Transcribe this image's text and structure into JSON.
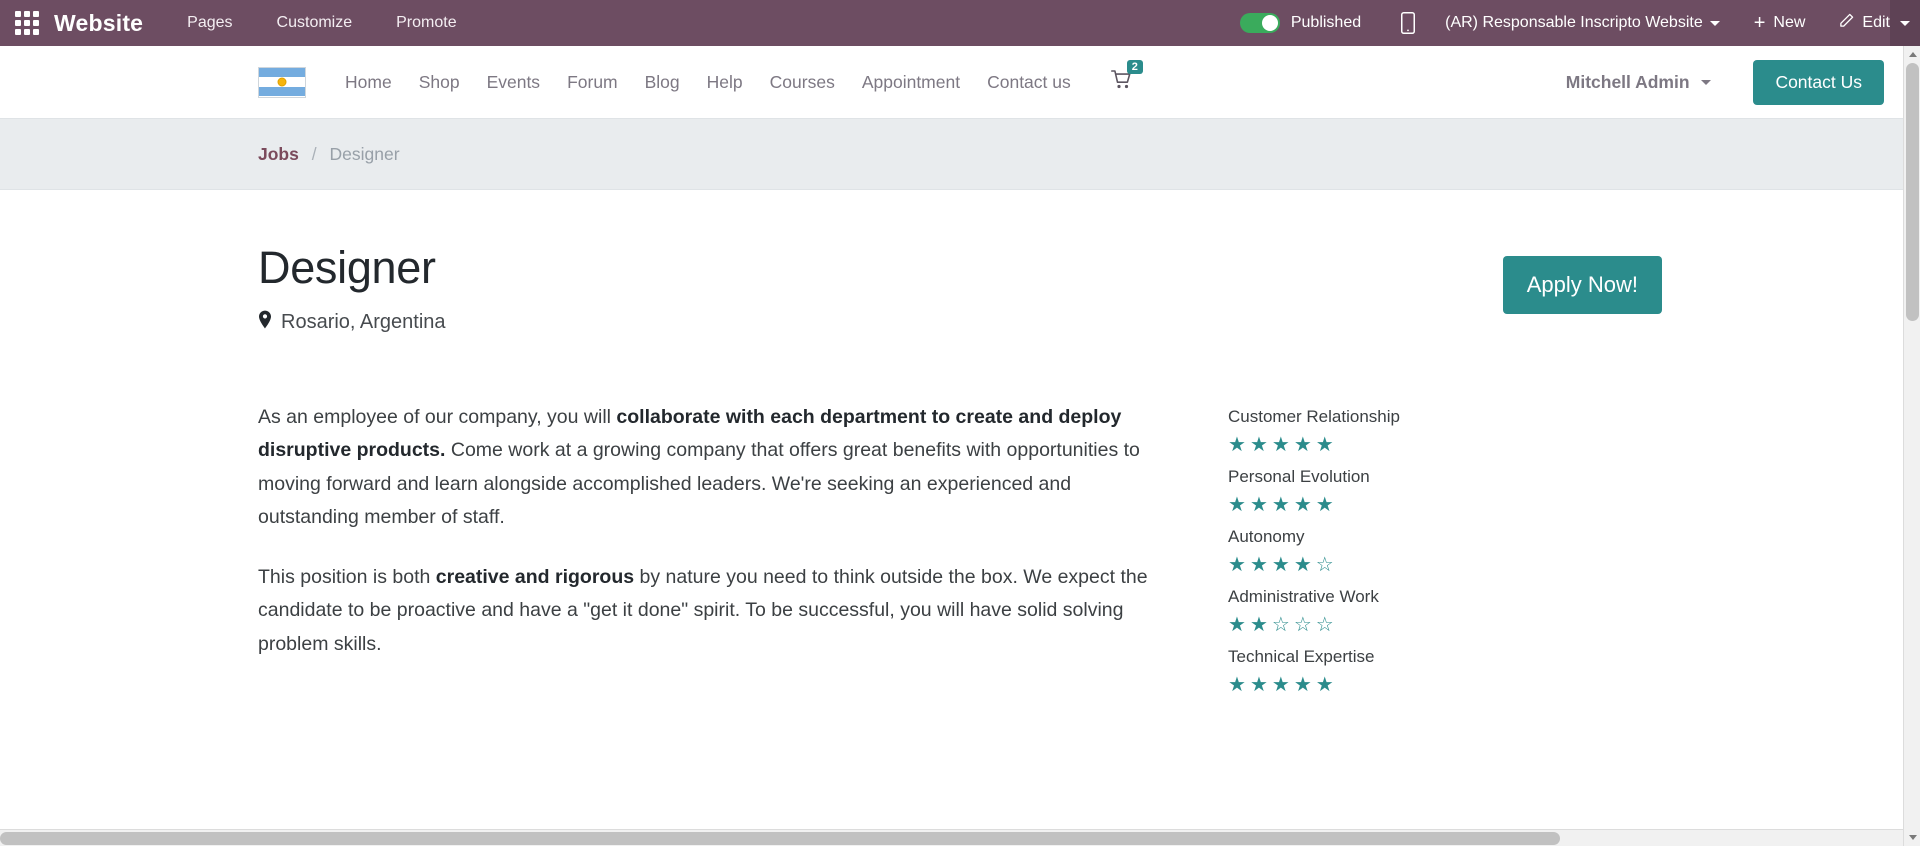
{
  "topbar": {
    "apps_icon": "grid-apps-icon",
    "brand": "Website",
    "menus": [
      "Pages",
      "Customize",
      "Promote"
    ],
    "published_label": "Published",
    "published_on": true,
    "mobile_icon": "mobile-preview-icon",
    "website_selector": "(AR) Responsable Inscripto Website",
    "new_label": "New",
    "new_icon": "plus-icon",
    "edit_label": "Edit",
    "edit_icon": "pencil-icon",
    "accent_color": "#6d4d62",
    "toggle_color": "#3aab5c"
  },
  "site_nav": {
    "logo": "argentina-flag-logo",
    "links": [
      "Home",
      "Shop",
      "Events",
      "Forum",
      "Blog",
      "Help",
      "Courses",
      "Appointment",
      "Contact us"
    ],
    "cart_icon": "shopping-cart-icon",
    "cart_count": "2",
    "user_name": "Mitchell Admin",
    "cta_label": "Contact Us",
    "cta_color": "#2b8c8c"
  },
  "breadcrumb": {
    "parent": "Jobs",
    "separator": "/",
    "current": "Designer"
  },
  "job": {
    "title": "Designer",
    "location_icon": "map-marker-icon",
    "location": "Rosario, Argentina",
    "apply_label": "Apply Now!"
  },
  "description": {
    "p1_a": "As an employee of our company, you will ",
    "p1_b": "collaborate with each department to create and deploy disruptive products.",
    "p1_c": " Come work at a growing company that offers great benefits with opportunities to moving forward and learn alongside accomplished leaders. We're seeking an experienced and outstanding member of staff.",
    "p2_a": "This position is both ",
    "p2_b": "creative and rigorous",
    "p2_c": " by nature you need to think outside the box. We expect the candidate to be proactive and have a \"get it done\" spirit. To be successful, you will have solid solving problem skills."
  },
  "ratings": [
    {
      "label": "Customer Relationship",
      "value": 5,
      "max": 5
    },
    {
      "label": "Personal Evolution",
      "value": 5,
      "max": 5
    },
    {
      "label": "Autonomy",
      "value": 4,
      "max": 5
    },
    {
      "label": "Administrative Work",
      "value": 2,
      "max": 5
    },
    {
      "label": "Technical Expertise",
      "value": 5,
      "max": 5
    }
  ],
  "star_color": "#2b8c8c",
  "scrollbars": {
    "vertical": true,
    "horizontal": true
  }
}
